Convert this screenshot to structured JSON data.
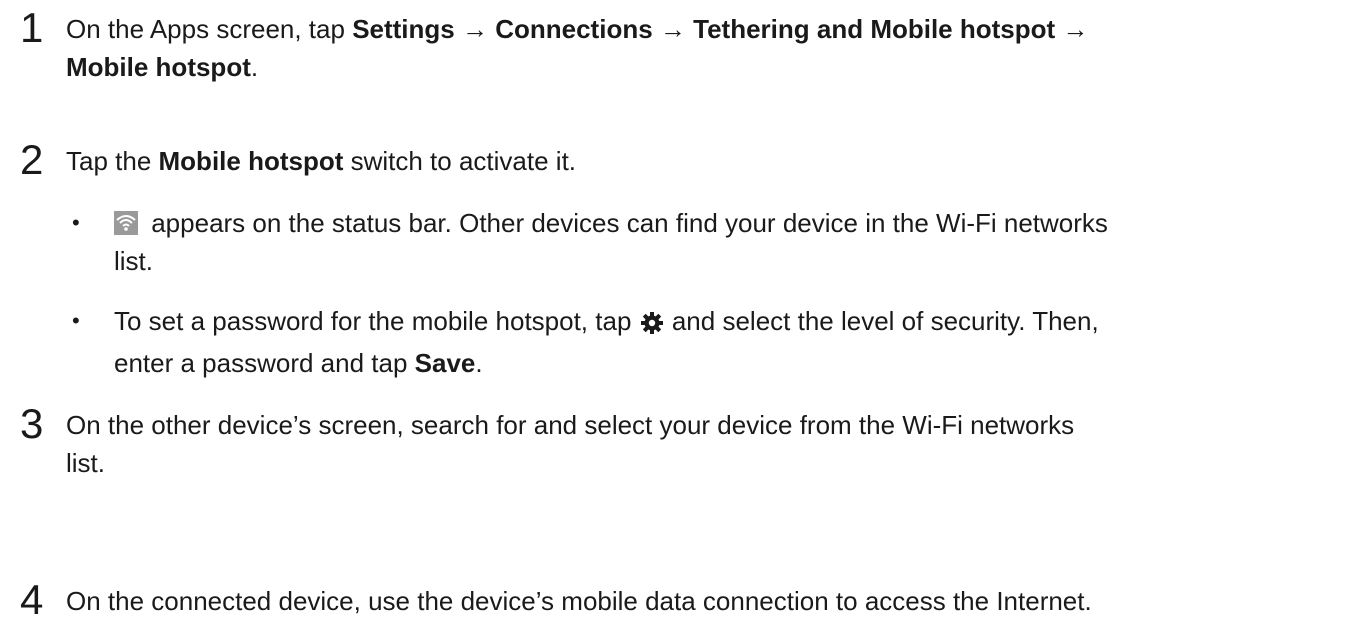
{
  "steps": [
    {
      "number": "1",
      "prefix": "On the Apps screen, tap ",
      "b1": "Settings",
      "arrow1": " → ",
      "b2": "Connections",
      "arrow2": " → ",
      "b3": "Tethering and Mobile hotspot",
      "arrow3": " →",
      "b4": "Mobile hotspot",
      "suffix": "."
    },
    {
      "number": "2",
      "prefix": "Tap the ",
      "bold": "Mobile hotspot",
      "suffix": " switch to activate it."
    },
    {
      "number": "3",
      "text_line1": "On the other device’s screen, search for and select your device from the Wi-Fi networks",
      "text_line2": "list."
    },
    {
      "number": "4",
      "text": "On the connected device, use the device’s mobile data connection to access the Internet."
    }
  ],
  "bullets": [
    {
      "marker": "•",
      "icon": "wifi-hotspot-icon",
      "line1": " appears on the status bar. Other devices can find your device in the Wi-Fi networks",
      "line2": "list."
    },
    {
      "marker": "•",
      "prefix": "To set a password for the mobile hotspot, tap ",
      "icon": "gear-icon",
      "middle": " and select the level of security. Then,",
      "line2_prefix": "enter a password and tap ",
      "line2_bold": "Save",
      "line2_suffix": "."
    }
  ]
}
